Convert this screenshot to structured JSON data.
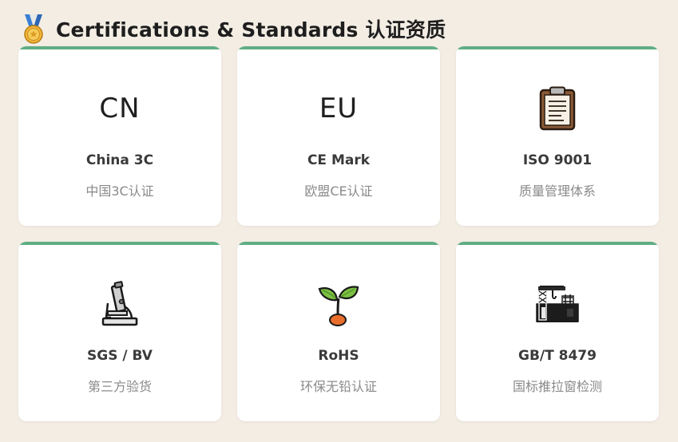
{
  "header": {
    "icon": "medal-icon",
    "title": "Certifications & Standards 认证资质"
  },
  "colors": {
    "background": "#f3ede4",
    "card_top_border": "#5fae83",
    "card_bg": "#ffffff"
  },
  "cards": [
    {
      "icon_text": "CN",
      "name": "China 3C",
      "sub": "中国3C认证"
    },
    {
      "icon_text": "EU",
      "name": "CE Mark",
      "sub": "欧盟CE认证"
    },
    {
      "icon": "clipboard-icon",
      "name": "ISO 9001",
      "sub": "质量管理体系"
    },
    {
      "icon": "microscope-icon",
      "name": "SGS / BV",
      "sub": "第三方验货"
    },
    {
      "icon": "seedling-icon",
      "name": "RoHS",
      "sub": "环保无铅认证"
    },
    {
      "icon": "construction-site-icon",
      "name": "GB/T 8479",
      "sub": "国标推拉窗检测"
    }
  ]
}
